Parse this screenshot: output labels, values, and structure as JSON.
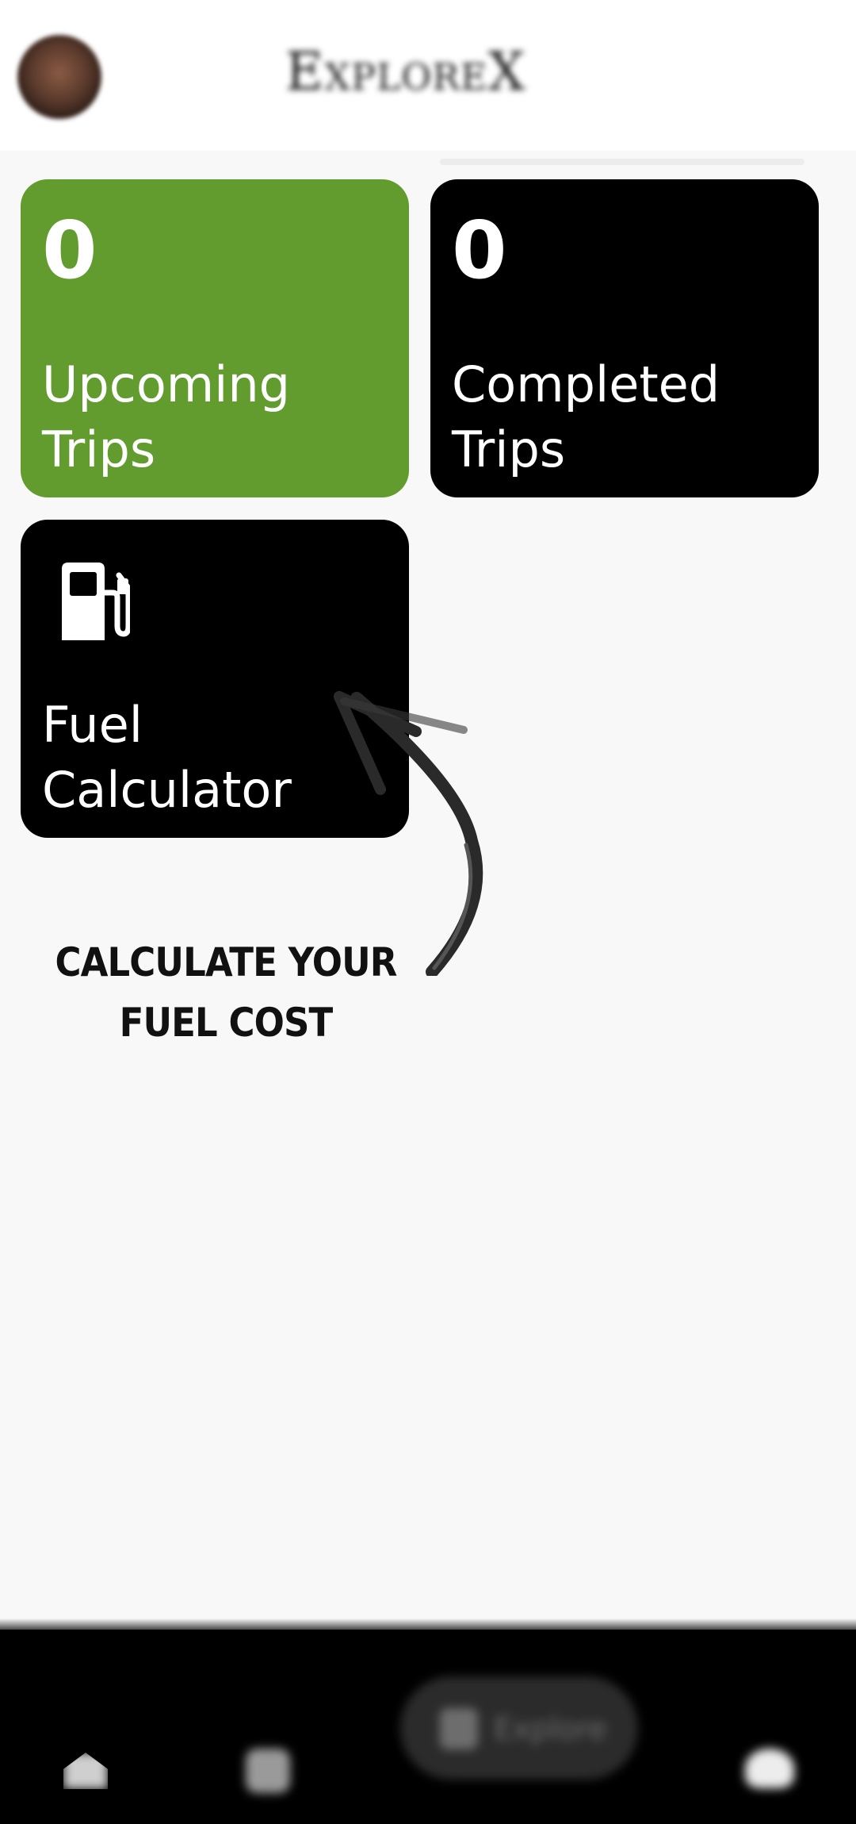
{
  "header": {
    "app_title": "ExploreX"
  },
  "tiles": [
    {
      "count": "0",
      "label_lines": [
        "Upcoming",
        "Trips"
      ],
      "color": "#629c2e"
    },
    {
      "count": "0",
      "label_lines": [
        "Completed",
        "Trips"
      ],
      "color": "#000000"
    },
    {
      "icon": "fuel-pump-icon",
      "label_lines": [
        "Fuel",
        "Calculator"
      ],
      "color": "#000000"
    }
  ],
  "annotation": {
    "lines": [
      "CALCULATE YOUR",
      "FUEL COST"
    ]
  },
  "bottom_nav": {
    "items": [
      {
        "icon": "home-icon"
      },
      {
        "icon": "trips-icon"
      },
      {
        "icon": "explore-icon",
        "label": "Explore",
        "active": true
      },
      {
        "icon": "profile-icon"
      }
    ]
  }
}
